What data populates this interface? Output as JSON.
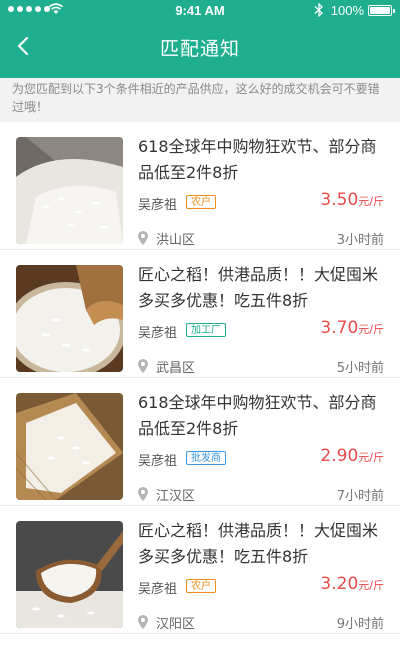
{
  "status_bar": {
    "time": "9:41 AM",
    "battery": "100%"
  },
  "header": {
    "title": "匹配通知"
  },
  "notice": "为您匹配到以下3个条件相近的产品供应，这么好的成交机会可不要错过哦！",
  "colors": {
    "primary": "#1fae8e",
    "price": "#e84a4a",
    "tag_orange": "#f08c1e",
    "tag_blue": "#3a96e0"
  },
  "items": [
    {
      "title": "618全球年中购物狂欢节、部分商品低至2件8折",
      "seller": "吴彦祖",
      "tag": "农户",
      "price": "3.50",
      "unit": "元/斤",
      "district": "洪山区",
      "time": "3小时前"
    },
    {
      "title": "匠心之稻！供港品质！！大促囤米多买多优惠！吃五件8折",
      "seller": "吴彦祖",
      "tag": "加工厂",
      "price": "3.70",
      "unit": "元/斤",
      "district": "武昌区",
      "time": "5小时前"
    },
    {
      "title": "618全球年中购物狂欢节、部分商品低至2件8折",
      "seller": "吴彦祖",
      "tag": "批发商",
      "price": "2.90",
      "unit": "元/斤",
      "district": "江汉区",
      "time": "7小时前"
    },
    {
      "title": "匠心之稻！供港品质！！大促囤米多买多优惠！吃五件8折",
      "seller": "吴彦祖",
      "tag": "农户",
      "price": "3.20",
      "unit": "元/斤",
      "district": "汉阳区",
      "time": "9小时前"
    }
  ]
}
